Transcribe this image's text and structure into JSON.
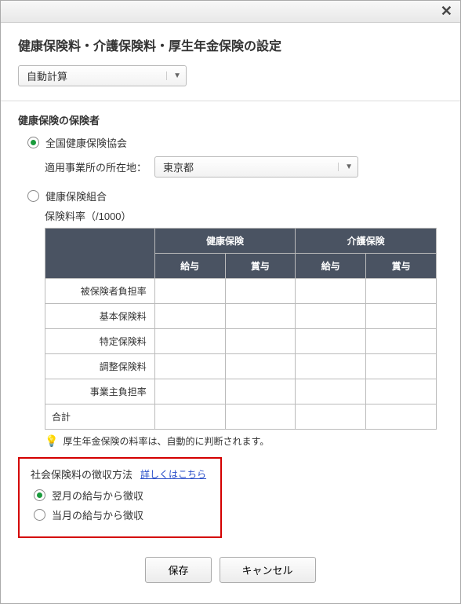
{
  "header": {
    "title": "健康保険料・介護保険料・厚生年金保険の設定"
  },
  "calc_select": {
    "value": "自動計算"
  },
  "insurer_section": {
    "title": "健康保険の保険者",
    "option_kyokai": "全国健康保険協会",
    "option_kumiai": "健康保険組合",
    "location_label": "適用事業所の所在地：",
    "location_value": "東京都",
    "rate_label": "保険料率（/1000）",
    "table": {
      "col_group_health": "健康保険",
      "col_group_care": "介護保険",
      "col_salary": "給与",
      "col_bonus": "賞与",
      "rows": [
        "被保険者負担率",
        "基本保険料",
        "特定保険料",
        "調整保険料",
        "事業主負担率",
        "合計"
      ]
    },
    "note": "厚生年金保険の料率は、自動的に判断されます。"
  },
  "collection_box": {
    "title": "社会保険料の徴収方法",
    "link": "詳しくはこちら",
    "option_next": "翌月の給与から徴収",
    "option_this": "当月の給与から徴収"
  },
  "buttons": {
    "save": "保存",
    "cancel": "キャンセル"
  }
}
